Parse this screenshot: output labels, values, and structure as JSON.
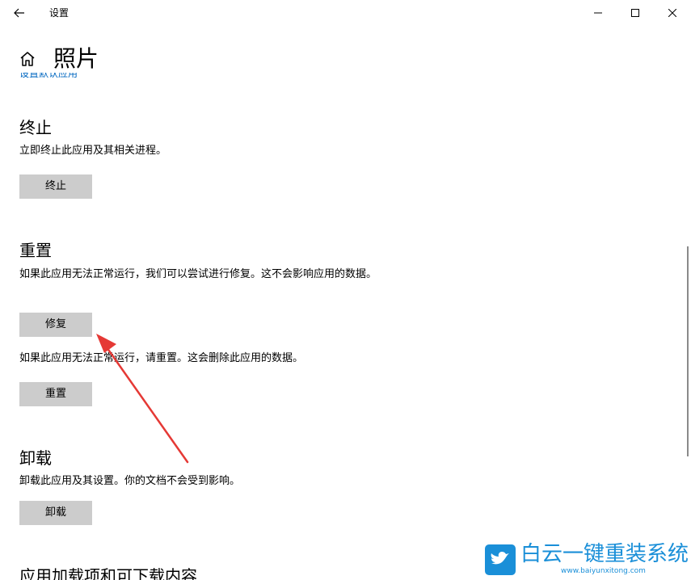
{
  "window": {
    "title": "设置"
  },
  "header": {
    "page_title": "照片",
    "cut_off_link": "设置默认应用"
  },
  "sections": {
    "terminate": {
      "heading": "终止",
      "description": "立即终止此应用及其相关进程。",
      "button_label": "终止"
    },
    "reset": {
      "heading": "重置",
      "repair_description": "如果此应用无法正常运行，我们可以尝试进行修复。这不会影响应用的数据。",
      "repair_button_label": "修复",
      "reset_description": "如果此应用无法正常运行，请重置。这会删除此应用的数据。",
      "reset_button_label": "重置"
    },
    "uninstall": {
      "heading": "卸载",
      "description": "卸载此应用及其设置。你的文档不会受到影响。",
      "button_label": "卸载"
    },
    "addons": {
      "heading": "应用加载项和可下载内容"
    }
  },
  "watermark": {
    "brand": "白云一键重装系统",
    "url": "www.baiyunxitong.com"
  },
  "colors": {
    "button_bg": "#cccccc",
    "link": "#0067c0",
    "annotation": "#e53935",
    "watermark": "#1a8fd8"
  },
  "icons": {
    "back": "arrow-left-icon",
    "home": "home-icon",
    "minimize": "minimize-icon",
    "maximize": "maximize-icon",
    "close": "close-icon"
  }
}
